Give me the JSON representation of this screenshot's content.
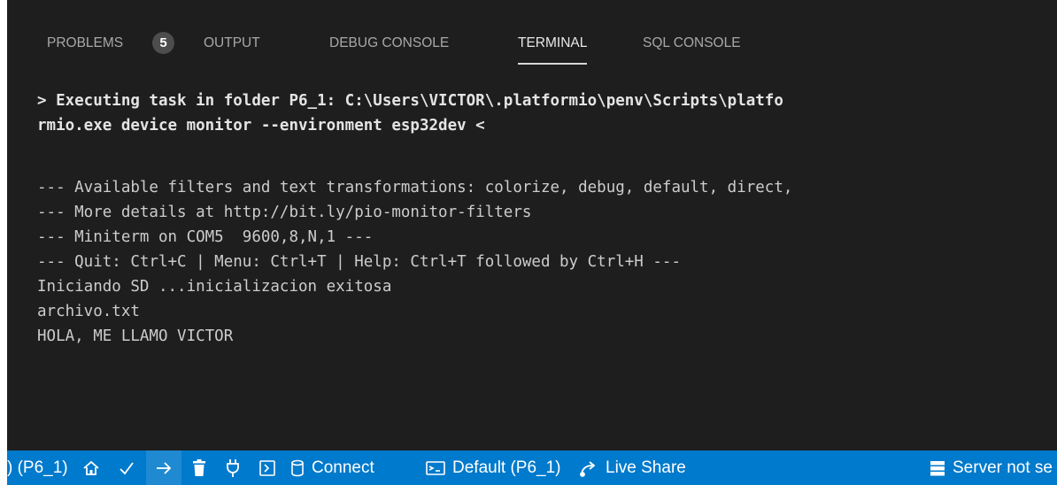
{
  "panel": {
    "tabs": [
      {
        "label": "PROBLEMS",
        "active": false
      },
      {
        "label": "OUTPUT",
        "active": false
      },
      {
        "label": "DEBUG CONSOLE",
        "active": false
      },
      {
        "label": "TERMINAL",
        "active": true
      },
      {
        "label": "SQL CONSOLE",
        "active": false
      }
    ],
    "problems_count": "5"
  },
  "terminal": {
    "lines": [
      "> Executing task in folder P6_1: C:\\Users\\VICTOR\\.platformio\\penv\\Scripts\\platfo",
      "rmio.exe device monitor --environment esp32dev <",
      "",
      "--- Available filters and text transformations: colorize, debug, default, direct,",
      "--- More details at http://bit.ly/pio-monitor-filters",
      "--- Miniterm on COM5  9600,8,N,1 ---",
      "--- Quit: Ctrl+C | Menu: Ctrl+T | Help: Ctrl+T followed by Ctrl+H ---",
      "Iniciando SD ...inicializacion exitosa",
      "archivo.txt",
      "HOLA, ME LLAMO VICTOR"
    ]
  },
  "statusbar": {
    "workspace": ") (P6_1)",
    "icons": [
      "home-icon",
      "check-icon",
      "arrow-right-icon",
      "trash-icon",
      "plug-icon",
      "terminal-icon"
    ],
    "connect_label": "Connect",
    "default_label": "Default (P6_1)",
    "liveshare_label": "Live Share",
    "server_label": "Server not se",
    "background": "#007acc"
  }
}
